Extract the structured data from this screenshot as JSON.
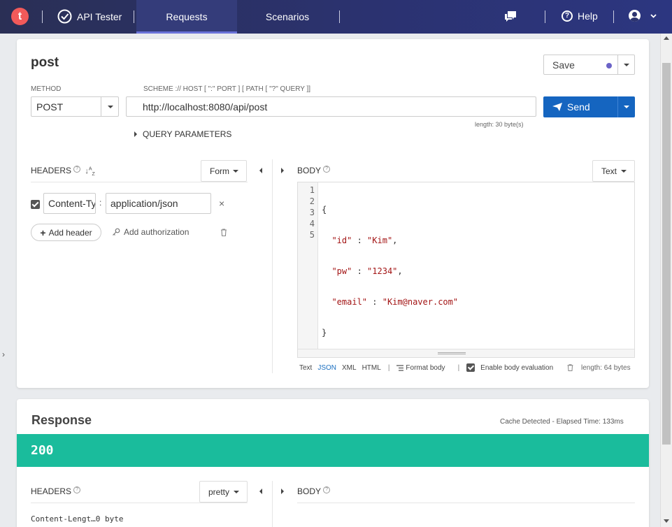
{
  "topbar": {
    "logo_letter": "t",
    "brand": "API Tester",
    "tabs": [
      {
        "label": "Requests",
        "active": true
      },
      {
        "label": "Scenarios",
        "active": false
      }
    ],
    "help_label": "Help",
    "accent_color": "#6a72d8"
  },
  "request": {
    "title": "post",
    "save_label": "Save",
    "method_label": "METHOD",
    "method_value": "POST",
    "url_label": "SCHEME :// HOST [ \":\" PORT ] [ PATH [ \"?\" QUERY ]]",
    "url_value": "http://localhost:8080/api/post",
    "url_length": "length: 30 byte(s)",
    "send_label": "Send",
    "query_params_label": "QUERY PARAMETERS"
  },
  "headers": {
    "label": "HEADERS",
    "mode": "Form",
    "rows": [
      {
        "checked": true,
        "key": "Content-Type",
        "value": "application/json"
      }
    ],
    "add_header_label": "Add header",
    "add_auth_label": "Add authorization"
  },
  "body": {
    "label": "BODY",
    "mode": "Text",
    "line_numbers": [
      "1",
      "2",
      "3",
      "4",
      "5"
    ],
    "code_lines": [
      {
        "pre": "{",
        "key": "",
        "sep": "",
        "val": "",
        "post": ""
      },
      {
        "pre": "  ",
        "key": "\"id\"",
        "sep": " : ",
        "val": "\"Kim\"",
        "post": ","
      },
      {
        "pre": "  ",
        "key": "\"pw\"",
        "sep": " : ",
        "val": "\"1234\"",
        "post": ","
      },
      {
        "pre": "  ",
        "key": "\"email\"",
        "sep": " : ",
        "val": "\"Kim@naver.com\"",
        "post": ""
      },
      {
        "pre": "}",
        "key": "",
        "sep": "",
        "val": "",
        "post": ""
      }
    ],
    "formats": [
      "Text",
      "JSON",
      "XML",
      "HTML"
    ],
    "active_format": "JSON",
    "format_body_label": "Format body",
    "enable_eval_label": "Enable body evaluation",
    "length": "length: 64 bytes"
  },
  "response": {
    "title": "Response",
    "meta": "Cache Detected - Elapsed Time: 133ms",
    "status": "200",
    "status_color": "#1abc9c",
    "headers_label": "HEADERS",
    "headers_mode": "pretty",
    "body_label": "BODY",
    "first_header": "Content-Lengt…0 byte"
  }
}
